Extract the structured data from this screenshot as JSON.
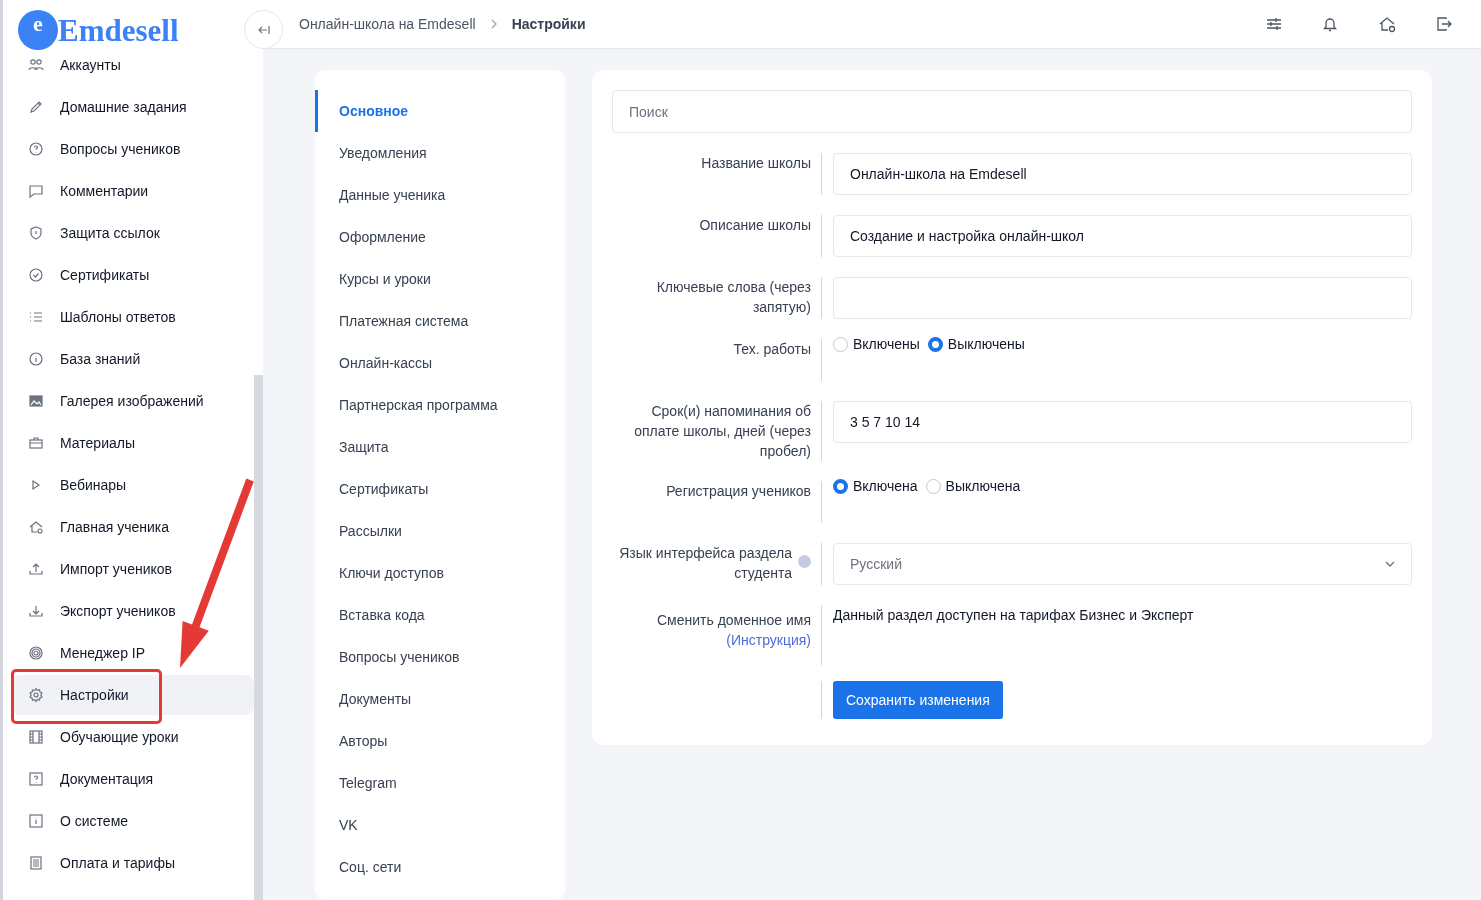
{
  "logo": {
    "mark": "e",
    "text": "Emdesell"
  },
  "sidebar": {
    "items": [
      {
        "label": "Аккаунты",
        "selected": false
      },
      {
        "label": "Домашние задания",
        "selected": false
      },
      {
        "label": "Вопросы учеников",
        "selected": false
      },
      {
        "label": "Комментарии",
        "selected": false
      },
      {
        "label": "Защита ссылок",
        "selected": false
      },
      {
        "label": "Сертификаты",
        "selected": false
      },
      {
        "label": "Шаблоны ответов",
        "selected": false
      },
      {
        "label": "База знаний",
        "selected": false
      },
      {
        "label": "Галерея изображений",
        "selected": false
      },
      {
        "label": "Материалы",
        "selected": false
      },
      {
        "label": "Вебинары",
        "selected": false
      },
      {
        "label": "Главная ученика",
        "selected": false
      },
      {
        "label": "Импорт учеников",
        "selected": false
      },
      {
        "label": "Экспорт учеников",
        "selected": false
      },
      {
        "label": "Менеджер IP",
        "selected": false
      },
      {
        "label": "Настройки",
        "selected": true
      },
      {
        "label": "Обучающие уроки",
        "selected": false
      },
      {
        "label": "Документация",
        "selected": false
      },
      {
        "label": "О системе",
        "selected": false
      },
      {
        "label": "Оплата и тарифы",
        "selected": false
      }
    ]
  },
  "breadcrumbs": [
    "Онлайн-школа на Emdesell",
    "Настройки"
  ],
  "settings_nav": [
    {
      "label": "Основное",
      "selected": true
    },
    {
      "label": "Уведомления",
      "selected": false
    },
    {
      "label": "Данные ученика",
      "selected": false
    },
    {
      "label": "Оформление",
      "selected": false
    },
    {
      "label": "Курсы и уроки",
      "selected": false
    },
    {
      "label": "Платежная система",
      "selected": false
    },
    {
      "label": "Онлайн-кассы",
      "selected": false
    },
    {
      "label": "Партнерская программа",
      "selected": false
    },
    {
      "label": "Защита",
      "selected": false
    },
    {
      "label": "Сертификаты",
      "selected": false
    },
    {
      "label": "Рассылки",
      "selected": false
    },
    {
      "label": "Ключи доступов",
      "selected": false
    },
    {
      "label": "Вставка кода",
      "selected": false
    },
    {
      "label": "Вопросы учеников",
      "selected": false
    },
    {
      "label": "Документы",
      "selected": false
    },
    {
      "label": "Авторы",
      "selected": false
    },
    {
      "label": "Telegram",
      "selected": false
    },
    {
      "label": "VK",
      "selected": false
    },
    {
      "label": "Соц. сети",
      "selected": false
    }
  ],
  "form": {
    "search": {
      "placeholder": "Поиск"
    },
    "rows": [
      {
        "kind": "input",
        "label": "Название школы",
        "value": "Онлайн-школа на Emdesell"
      },
      {
        "kind": "input",
        "label": "Описание школы",
        "value": "Создание и настройка онлайн-школ"
      },
      {
        "kind": "input",
        "label": "Ключевые слова (через запятую)"
      },
      {
        "kind": "radio",
        "label": "Тех. работы",
        "options": [
          {
            "label": "Включены",
            "selected": false
          },
          {
            "label": "Выключены",
            "selected": true
          }
        ]
      },
      {
        "kind": "input",
        "label": "Срок(и) напоминания об оплате школы, дней (через пробел)",
        "value": "3 5 7 10 14"
      },
      {
        "kind": "radio",
        "label": "Регистрация учеников",
        "options": [
          {
            "label": "Включена",
            "selected": true
          },
          {
            "label": "Выключена",
            "selected": false
          }
        ]
      },
      {
        "kind": "select",
        "label": "Язык интерфейса раздела студента",
        "value": "Русский"
      },
      {
        "kind": "text",
        "label": "Сменить доменное имя",
        "link": "(Инструкция)",
        "text": "Данный раздел доступен на тарифах Бизнес и Эксперт"
      }
    ],
    "save_button": "Сохранить изменения"
  }
}
